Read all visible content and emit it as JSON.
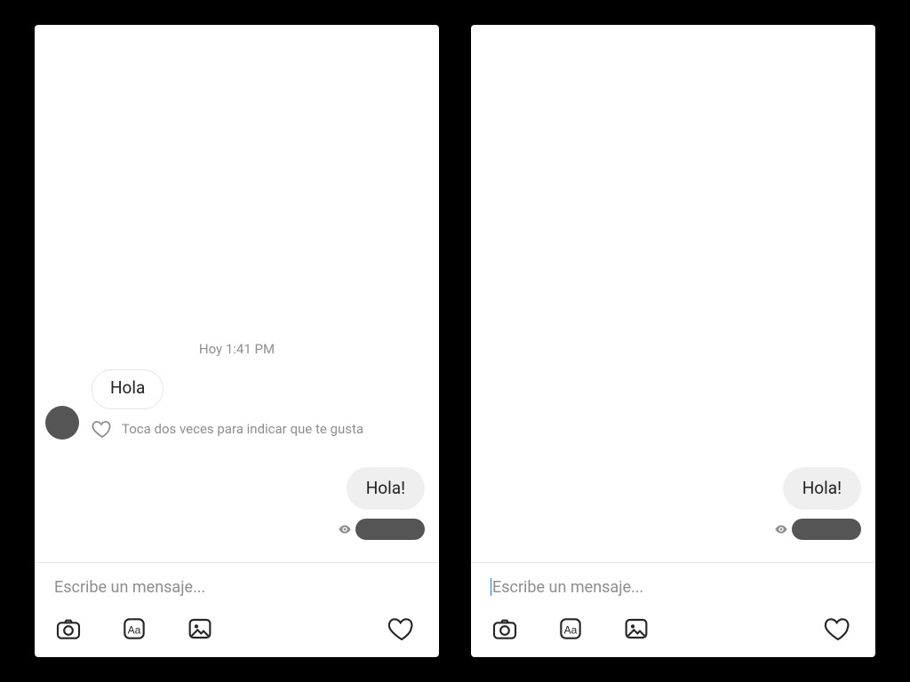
{
  "left": {
    "timestamp": "Hoy 1:41 PM",
    "incoming": {
      "text": "Hola"
    },
    "like_hint": "Toca dos veces para indicar que te gusta",
    "outgoing": {
      "text": "Hola!"
    },
    "composer": {
      "placeholder": "Escribe un mensaje..."
    },
    "show_caret": false
  },
  "right": {
    "outgoing": {
      "text": "Hola!"
    },
    "composer": {
      "placeholder": "Escribe un mensaje..."
    },
    "show_caret": true
  },
  "icons": {
    "camera": "camera-icon",
    "text": "text-style-icon",
    "gallery": "gallery-icon",
    "heart": "heart-icon",
    "eye": "seen-eye-icon"
  }
}
